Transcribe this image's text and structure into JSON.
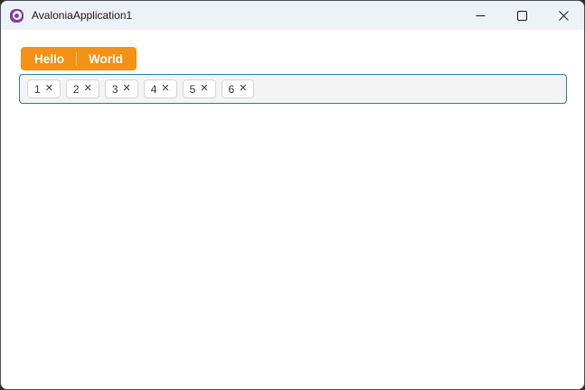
{
  "window": {
    "title": "AvaloniaApplication1",
    "icon": "avalonia-logo",
    "controls": {
      "minimize": "minimize-icon",
      "maximize": "maximize-icon",
      "close": "close-icon"
    }
  },
  "colors": {
    "titlebar_bg": "#EDF2F8",
    "accent_orange": "#F59114",
    "chipbar_border": "#3679A9",
    "chipbar_bg": "#F2F4F6",
    "logo_purple": "#8140A5"
  },
  "split_button": {
    "left_label": "Hello",
    "right_label": "World"
  },
  "chips": {
    "items": [
      {
        "label": "1"
      },
      {
        "label": "2"
      },
      {
        "label": "3"
      },
      {
        "label": "4"
      },
      {
        "label": "5"
      },
      {
        "label": "6"
      }
    ],
    "remove_icon": "✕"
  }
}
